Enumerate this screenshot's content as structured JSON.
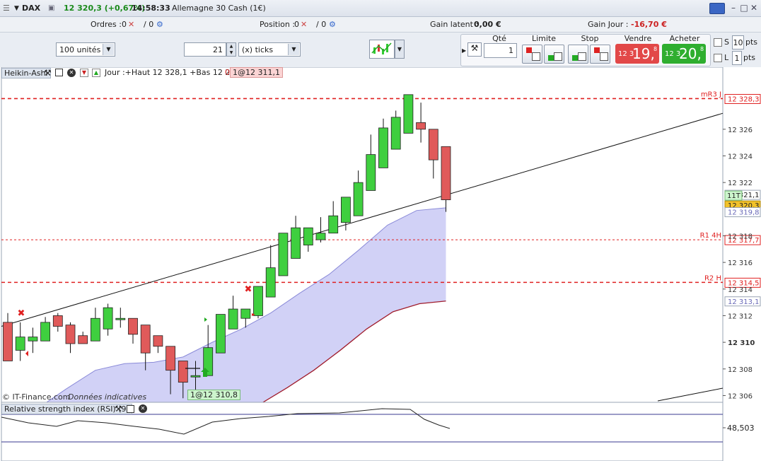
{
  "title": {
    "instrument": "DAX",
    "price": "12 320,3 (+0,67%)",
    "time": "14:58:33",
    "name": "Allemagne 30 Cash (1€)"
  },
  "info": {
    "orders_label": "Ordres :",
    "orders_val": "0",
    "orders_val2": "/ 0",
    "position_label": "Position :",
    "position_val": "0",
    "position_val2": "/ 0",
    "gain_latent_label": "Gain latent :",
    "gain_latent_val": "0,00 €",
    "gain_jour_label": "Gain Jour :",
    "gain_jour_val": "-16,70 €"
  },
  "toolbar": {
    "units": "100 unités",
    "ticks_value": "21",
    "ticks_unit": "(x) ticks",
    "qty_label": "Qté",
    "qty_value": "1",
    "limit_label": "Limite",
    "stop_label": "Stop",
    "sell_label": "Vendre",
    "buy_label": "Acheter",
    "sell_small": "12 3",
    "sell_big": "19,",
    "sell_sup": "8",
    "buy_small": "12 3",
    "buy_big": "20,",
    "buy_sup": "8",
    "s_label": "S",
    "s_value": "10",
    "s_unit": "pts",
    "l_label": "L",
    "l_value": "1",
    "l_unit": "pts"
  },
  "chart_header": {
    "type": "Heikin-Ashi",
    "summary": "Jour :+Haut 12 328,1 +Bas 12 204,",
    "tag": "0",
    "order_label": "1@12 311,1"
  },
  "footer": {
    "copyright": "© IT-Finance.com",
    "note": "Données indicatives",
    "entry_label": "1@12 310,8",
    "rsi_label": "Relative strength index (RSI) (9)",
    "rsi_value": "48,503"
  },
  "colors": {
    "up": "#3fcf3f",
    "down": "#e05a5a",
    "band": "#c9c9f5",
    "level": "#e02020",
    "sell_bg": "#e24848",
    "buy_bg": "#2fae2f"
  },
  "chart_data": {
    "type": "heikin-ashi",
    "yaxis_ticks": [
      "12 326",
      "12 324",
      "12 322",
      "12 318",
      "12 316",
      "12 314",
      "12 312",
      "12 310",
      "12 308",
      "12 306"
    ],
    "ylim": [
      12305.6,
      12329.6
    ],
    "levels": [
      {
        "label": "mR3 J",
        "value": "12 328,3",
        "price": 12328.3,
        "bold": true
      },
      {
        "label": "R1 4H",
        "value": "12 317,7",
        "price": 12317.7,
        "bold": false
      },
      {
        "label": "R2 H",
        "value": "12 314,5",
        "price": 12314.5,
        "bold": true
      }
    ],
    "price_labels": [
      {
        "value": "12 321,1",
        "price": 12321.1
      },
      {
        "value": "12 320,3",
        "price": 12320.3,
        "tag": "11T"
      },
      {
        "value": "12 319,8",
        "price": 12319.8
      },
      {
        "value": "12 313,1",
        "price": 12313.1
      }
    ],
    "candles": [
      {
        "o": 12311.5,
        "c": 12308.6,
        "h": 12312.2,
        "l": 12308.6
      },
      {
        "o": 12309.4,
        "c": 12310.4,
        "h": 12311.5,
        "l": 12308.6
      },
      {
        "o": 12310.1,
        "c": 12310.4,
        "h": 12311.1,
        "l": 12309.2
      },
      {
        "o": 12310.1,
        "c": 12311.5,
        "h": 12311.9,
        "l": 12310.1
      },
      {
        "o": 12312.0,
        "c": 12311.2,
        "h": 12312.2,
        "l": 12310.8
      },
      {
        "o": 12311.3,
        "c": 12309.9,
        "h": 12311.5,
        "l": 12309.2
      },
      {
        "o": 12310.5,
        "c": 12309.9,
        "h": 12310.8,
        "l": 12309.9
      },
      {
        "o": 12310.1,
        "c": 12311.8,
        "h": 12312.6,
        "l": 12310.1
      },
      {
        "o": 12311.0,
        "c": 12312.6,
        "h": 12312.9,
        "l": 12310.5
      },
      {
        "o": 12311.8,
        "c": 12311.8,
        "h": 12312.6,
        "l": 12311.1
      },
      {
        "o": 12311.8,
        "c": 12310.6,
        "h": 12311.8,
        "l": 12309.9
      },
      {
        "o": 12311.3,
        "c": 12309.2,
        "h": 12311.3,
        "l": 12307.9
      },
      {
        "o": 12310.5,
        "c": 12309.7,
        "h": 12310.5,
        "l": 12309.2
      },
      {
        "o": 12309.7,
        "c": 12307.9,
        "h": 12309.7,
        "l": 12306.1
      },
      {
        "o": 12308.6,
        "c": 12307.0,
        "h": 12308.6,
        "l": 12305.8
      },
      {
        "o": 12307.5,
        "c": 12307.5,
        "h": 12308.6,
        "l": 12306.3
      },
      {
        "o": 12307.5,
        "c": 12309.6,
        "h": 12311.3,
        "l": 12307.5
      },
      {
        "o": 12309.2,
        "c": 12312.1,
        "h": 12312.1,
        "l": 12309.2
      },
      {
        "o": 12311.0,
        "c": 12312.5,
        "h": 12313.5,
        "l": 12311.0
      },
      {
        "o": 12311.8,
        "c": 12312.5,
        "h": 12312.5,
        "l": 12311.1
      },
      {
        "o": 12312.0,
        "c": 12314.2,
        "h": 12314.2,
        "l": 12311.8
      },
      {
        "o": 12313.4,
        "c": 12315.6,
        "h": 12317.3,
        "l": 12313.4
      },
      {
        "o": 12315.0,
        "c": 12318.2,
        "h": 12318.2,
        "l": 12315.0
      },
      {
        "o": 12316.3,
        "c": 12318.6,
        "h": 12319.5,
        "l": 12316.3
      },
      {
        "o": 12317.3,
        "c": 12318.6,
        "h": 12318.6,
        "l": 12316.8
      },
      {
        "o": 12317.7,
        "c": 12318.2,
        "h": 12319.4,
        "l": 12317.5
      },
      {
        "o": 12318.2,
        "c": 12319.5,
        "h": 12320.6,
        "l": 12318.2
      },
      {
        "o": 12319.0,
        "c": 12320.9,
        "h": 12320.9,
        "l": 12318.4
      },
      {
        "o": 12319.5,
        "c": 12322.0,
        "h": 12322.9,
        "l": 12319.5
      },
      {
        "o": 12321.4,
        "c": 12324.1,
        "h": 12325.6,
        "l": 12321.4
      },
      {
        "o": 12323.1,
        "c": 12326.1,
        "h": 12326.8,
        "l": 12323.1
      },
      {
        "o": 12324.5,
        "c": 12326.9,
        "h": 12327.4,
        "l": 12324.5
      },
      {
        "o": 12325.7,
        "c": 12328.6,
        "h": 12328.6,
        "l": 12325.7
      },
      {
        "o": 12326.5,
        "c": 12326.0,
        "h": 12328.0,
        "l": 12325.0
      },
      {
        "o": 12326.0,
        "c": 12323.7,
        "h": 12326.0,
        "l": 12322.3
      },
      {
        "o": 12324.7,
        "c": 12320.7,
        "h": 12324.7,
        "l": 12319.8
      }
    ],
    "trendline": [
      [
        12311.2,
        0
      ],
      [
        12327.2,
        1
      ]
    ],
    "band_top": [
      12304.2,
      12305.0,
      12306.5,
      12307.9,
      12308.4,
      12308.5,
      12308.9,
      12310.0,
      12311.0,
      12312.2,
      12313.7,
      12315.1,
      12316.9,
      12318.8,
      12319.9,
      12320.1
    ],
    "band_bottom": [
      12304.2,
      12304.6,
      12305.4,
      12306.6,
      12307.9,
      12309.4,
      12311.0,
      12312.3,
      12312.9,
      12313.1
    ]
  }
}
